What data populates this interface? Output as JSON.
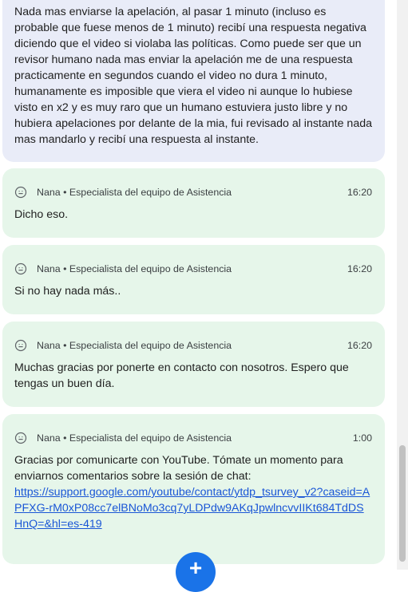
{
  "user_message": {
    "text": "Nada mas enviarse la apelación, al pasar 1 minuto (incluso es probable que fuese menos de 1 minuto) recibí una respuesta negativa diciendo que el video si violaba las políticas. Como puede ser que un revisor humano nada mas enviar la apelación me de una respuesta practicamente en segundos cuando el video no dura 1 minuto, humanamente es imposible que viera el video ni aunque lo hubiese visto en x2 y es muy raro que un humano estuviera justo libre y no hubiera apelaciones por delante de la mia, fui revisado al instante nada mas mandarlo y recibí una respuesta al instante."
  },
  "agent_messages": [
    {
      "sender": "Nana • Especialista del equipo de Asistencia",
      "time": "16:20",
      "text": "Dicho eso."
    },
    {
      "sender": "Nana • Especialista del equipo de Asistencia",
      "time": "16:20",
      "text": "Si no hay nada más.."
    },
    {
      "sender": "Nana • Especialista del equipo de Asistencia",
      "time": "16:20",
      "text": "Muchas gracias por ponerte en contacto con nosotros. Espero que tengas un buen día."
    },
    {
      "sender": "Nana • Especialista del equipo de Asistencia",
      "time": "1:00",
      "text": "Gracias por comunicarte con YouTube. Tómate un momento para enviarnos comentarios sobre la sesión de chat:",
      "link": "https://support.google.com/youtube/contact/ytdp_tsurvey_v2?caseid=APFXG-rM0xP08cc7elBNoMo3cq7yLDPdw9AKqJpwlncvvIIKt684TdDSHnQ=&hl=es-419"
    }
  ],
  "icons": {
    "agent_avatar": "smiley-face-icon",
    "fab": "plus-icon"
  },
  "fab": {
    "label": "+"
  },
  "colors": {
    "user_bubble": "#e9ecf8",
    "agent_bubble": "#e6f6ea",
    "link": "#1a56d6",
    "fab": "#1a73e8"
  }
}
